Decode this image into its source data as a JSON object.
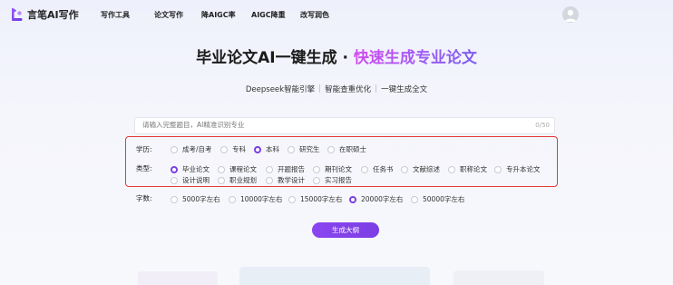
{
  "brand": {
    "name": "言笔AI写作"
  },
  "nav": {
    "items": [
      {
        "label": "写作工具"
      },
      {
        "label": "论文写作"
      },
      {
        "label": "降AIGC率"
      },
      {
        "label": "AIGC降重"
      },
      {
        "label": "改写润色"
      }
    ]
  },
  "hero": {
    "title_main": "毕业论文AI一键生成 · ",
    "title_accent": "快速生成专业论文",
    "features": [
      "Deepseek智能引擎",
      "智能查重优化",
      "一键生成全文"
    ]
  },
  "topic": {
    "placeholder": "请输入完整题目，AI精准识别专业",
    "value": "",
    "counter": "0/50"
  },
  "education": {
    "label": "学历:",
    "options": [
      {
        "label": "成考/自考",
        "selected": false
      },
      {
        "label": "专科",
        "selected": false
      },
      {
        "label": "本科",
        "selected": true
      },
      {
        "label": "研究生",
        "selected": false
      },
      {
        "label": "在职硕士",
        "selected": false
      }
    ]
  },
  "type": {
    "label": "类型:",
    "options": [
      {
        "label": "毕业论文",
        "selected": true
      },
      {
        "label": "课程论文",
        "selected": false
      },
      {
        "label": "开题报告",
        "selected": false
      },
      {
        "label": "期刊论文",
        "selected": false
      },
      {
        "label": "任务书",
        "selected": false
      },
      {
        "label": "文献综述",
        "selected": false
      },
      {
        "label": "职称论文",
        "selected": false
      },
      {
        "label": "专升本论文",
        "selected": false
      },
      {
        "label": "设计说明",
        "selected": false
      },
      {
        "label": "职业规划",
        "selected": false
      },
      {
        "label": "教学设计",
        "selected": false
      },
      {
        "label": "实习报告",
        "selected": false
      }
    ]
  },
  "words": {
    "label": "字数:",
    "options": [
      {
        "label": "5000字左右",
        "selected": false
      },
      {
        "label": "10000字左右",
        "selected": false
      },
      {
        "label": "15000字左右",
        "selected": false
      },
      {
        "label": "20000字左右",
        "selected": true
      },
      {
        "label": "50000字左右",
        "selected": false
      }
    ]
  },
  "actions": {
    "generate_label": "生成大纲"
  },
  "colors": {
    "accent": "#7b3fe4",
    "highlight_border": "#e03a3a",
    "title_gradient_start": "#d14cf0"
  }
}
